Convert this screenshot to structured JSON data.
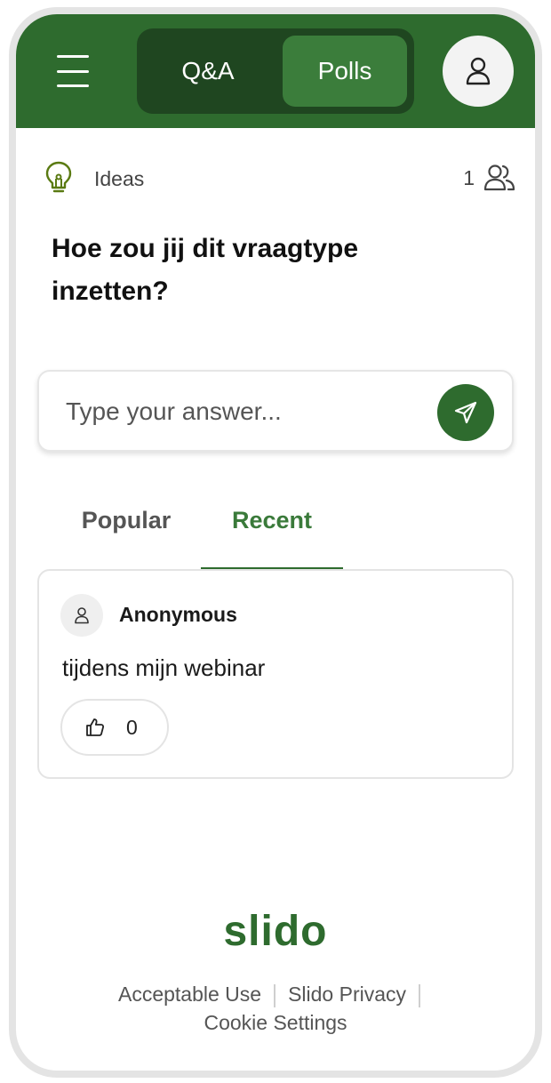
{
  "header": {
    "tabs": [
      {
        "label": "Q&A",
        "active": false
      },
      {
        "label": "Polls",
        "active": true
      }
    ],
    "colors": {
      "bar": "#2e6b2e",
      "switch_bg": "#1f4620",
      "active_tab": "#3b7d3b"
    }
  },
  "question": {
    "category": "Ideas",
    "participants": "1",
    "text": "Hoe zou jij dit vraagtype inzetten?"
  },
  "answer_input": {
    "placeholder": "Type your answer...",
    "value": ""
  },
  "sort_tabs": [
    {
      "label": "Popular",
      "active": false
    },
    {
      "label": "Recent",
      "active": true
    }
  ],
  "answers": [
    {
      "author": "Anonymous",
      "text": "tijdens mijn webinar",
      "likes": "0"
    }
  ],
  "footer": {
    "logo": "slido",
    "links": [
      "Acceptable Use",
      "Slido Privacy",
      "Cookie Settings"
    ]
  },
  "icons": [
    "menu-icon",
    "user-icon",
    "lightbulb-icon",
    "participants-icon",
    "send-icon",
    "thumbs-up-icon"
  ]
}
